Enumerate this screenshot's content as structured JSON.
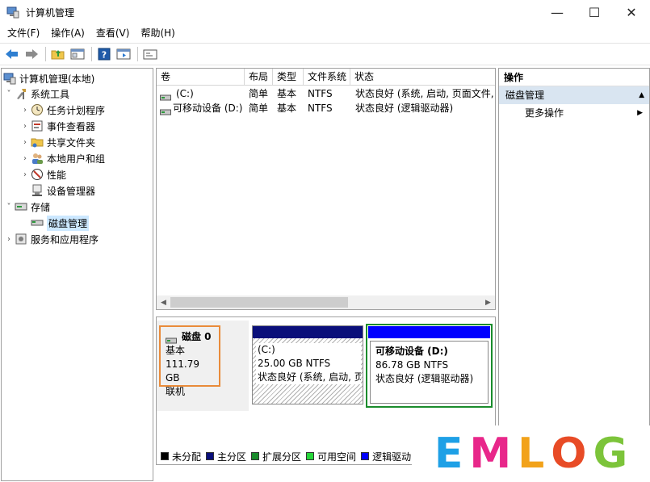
{
  "window": {
    "title": "计算机管理",
    "controls": {
      "minimize": "—",
      "maximize": "☐",
      "close": "✕"
    }
  },
  "menu": [
    "文件(F)",
    "操作(A)",
    "查看(V)",
    "帮助(H)"
  ],
  "toolbar": [
    "back-icon",
    "forward-icon",
    "up-folder-icon",
    "show-hide-tree-icon",
    "help-icon",
    "properties-icon",
    "console-icon"
  ],
  "tree": {
    "root": "计算机管理(本地)",
    "system_tools": "系统工具",
    "task_scheduler": "任务计划程序",
    "event_viewer": "事件查看器",
    "shared_folders": "共享文件夹",
    "local_users": "本地用户和组",
    "performance": "性能",
    "device_manager": "设备管理器",
    "storage": "存储",
    "disk_management": "磁盘管理",
    "services": "服务和应用程序"
  },
  "volumes": {
    "headers": [
      "卷",
      "布局",
      "类型",
      "文件系统",
      "状态"
    ],
    "rows": [
      {
        "name": "(C:)",
        "layout": "简单",
        "type": "基本",
        "fs": "NTFS",
        "status": "状态良好 (系统, 启动, 页面文件,"
      },
      {
        "name": "可移动设备 (D:)",
        "layout": "简单",
        "type": "基本",
        "fs": "NTFS",
        "status": "状态良好 (逻辑驱动器)"
      }
    ]
  },
  "disk": {
    "name": "磁盘 0",
    "type": "基本",
    "size": "111.79 GB",
    "state": "联机",
    "partitions": [
      {
        "label": "(C:)",
        "size": "25.00 GB NTFS",
        "status": "状态良好 (系统, 启动, 页"
      },
      {
        "label": "可移动设备  (D:)",
        "size": "86.78 GB NTFS",
        "status": "状态良好 (逻辑驱动器)"
      }
    ]
  },
  "legend": [
    {
      "label": "未分配",
      "color": "#000000"
    },
    {
      "label": "主分区",
      "color": "#0a0f7a"
    },
    {
      "label": "扩展分区",
      "color": "#1a8c2c"
    },
    {
      "label": "可用空间",
      "color": "#26d63a"
    },
    {
      "label": "逻辑驱动",
      "color": "#0000ff"
    }
  ],
  "actions": {
    "header": "操作",
    "section": "磁盘管理",
    "more": "更多操作"
  },
  "watermark": {
    "letters": [
      "E",
      "M",
      "L",
      "O",
      "G"
    ],
    "colors": [
      "#1ea0e6",
      "#e8278a",
      "#f2a21a",
      "#e84b26",
      "#7cc43a"
    ]
  }
}
